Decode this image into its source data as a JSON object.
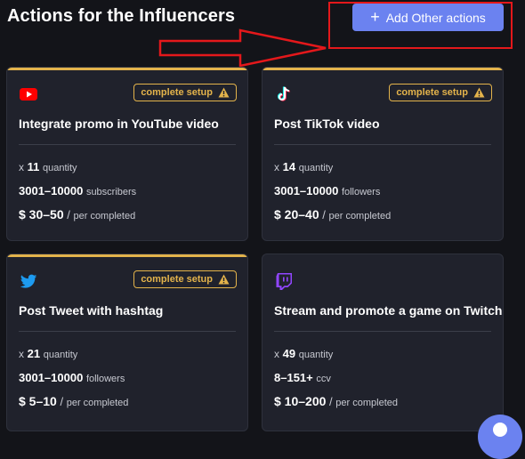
{
  "header": {
    "title": "Actions for the Influencers",
    "add_button": {
      "label": "Add Other actions",
      "icon": "plus-icon"
    }
  },
  "colors": {
    "background": "#131419",
    "card": "#20222c",
    "accent": "#6b82f0",
    "warning": "#e3b34b",
    "annotation": "#e4181b"
  },
  "cards": [
    {
      "platform": "youtube-icon",
      "badge": "complete setup",
      "title": "Integrate promo in YouTube video",
      "quantity_prefix": "x",
      "quantity": "11",
      "quantity_label": "quantity",
      "audience": "3001–10000",
      "audience_label": "subscribers",
      "price": "$ 30–50",
      "price_sep": "/",
      "price_label": "per completed"
    },
    {
      "platform": "tiktok-icon",
      "badge": "complete setup",
      "title": "Post TikTok video",
      "quantity_prefix": "x",
      "quantity": "14",
      "quantity_label": "quantity",
      "audience": "3001–10000",
      "audience_label": "followers",
      "price": "$ 20–40",
      "price_sep": "/",
      "price_label": "per completed"
    },
    {
      "platform": "twitter-icon",
      "badge": "complete setup",
      "title": "Post Tweet with hashtag",
      "quantity_prefix": "x",
      "quantity": "21",
      "quantity_label": "quantity",
      "audience": "3001–10000",
      "audience_label": "followers",
      "price": "$ 5–10",
      "price_sep": "/",
      "price_label": "per completed"
    },
    {
      "platform": "twitch-icon",
      "title": "Stream and promote a game on Twitch",
      "quantity_prefix": "x",
      "quantity": "49",
      "quantity_label": "quantity",
      "audience": "8–151+",
      "audience_label": "ccv",
      "price": "$ 10–200",
      "price_sep": "/",
      "price_label": "per completed"
    }
  ]
}
